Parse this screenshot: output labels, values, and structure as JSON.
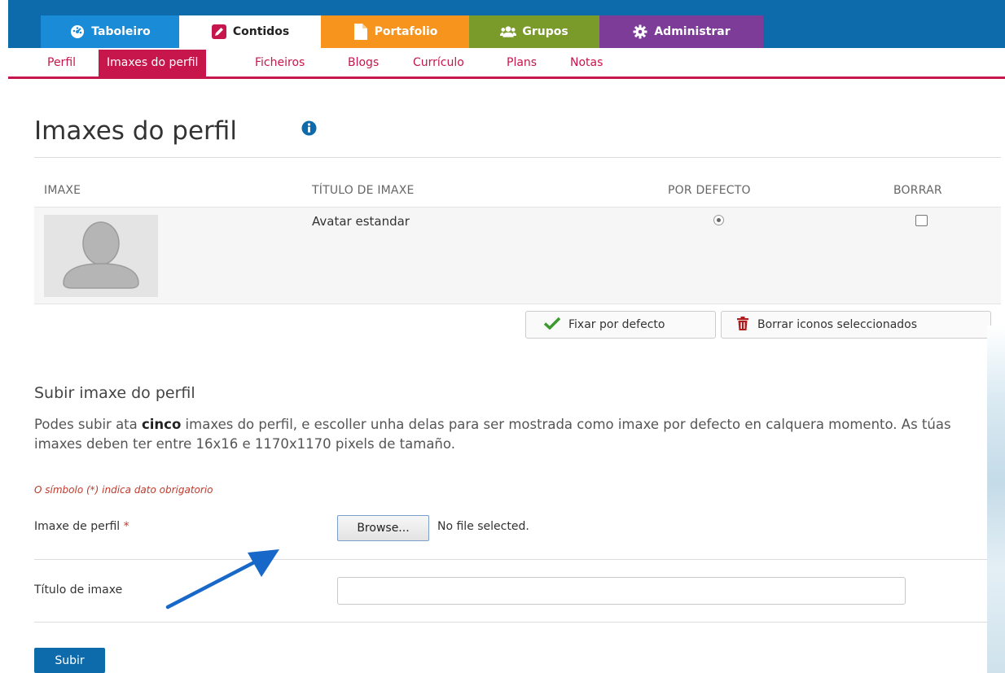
{
  "colors": {
    "top_bar": "#0e6bab",
    "tab_dashboard": "#1a8bd6",
    "tab_content": "#ffffff",
    "tab_portfolio": "#f7941d",
    "tab_groups": "#7a9a2a",
    "tab_admin": "#7d3c98",
    "accent": "#c6164b"
  },
  "main_nav": {
    "tabs": [
      {
        "label": "Taboleiro",
        "icon": "dashboard-icon"
      },
      {
        "label": "Contidos",
        "icon": "pencil-icon"
      },
      {
        "label": "Portafolio",
        "icon": "file-icon"
      },
      {
        "label": "Grupos",
        "icon": "users-icon"
      },
      {
        "label": "Administrar",
        "icon": "gear-icon"
      }
    ]
  },
  "sub_nav": {
    "items": [
      "Perfil",
      "Imaxes do perfil",
      "Ficheiros",
      "Blogs",
      "Currículo",
      "Plans",
      "Notas"
    ],
    "active": "Imaxes do perfil"
  },
  "page": {
    "title": "Imaxes do perfil",
    "info_icon": "info-icon"
  },
  "table": {
    "headers": [
      "IMAXE",
      "TÍTULO DE IMAXE",
      "POR DEFECTO",
      "BORRAR"
    ],
    "rows": [
      {
        "image": "default-avatar",
        "title": "Avatar estandar",
        "default_selected": true,
        "delete_checked": false
      }
    ]
  },
  "actions": {
    "set_default": "Fixar por defecto",
    "delete_selected": "Borrar iconos seleccionados"
  },
  "upload": {
    "heading": "Subir imaxe do perfil",
    "desc_before": "Podes subir ata ",
    "desc_bold": "cinco",
    "desc_after": " imaxes do perfil, e escoller unha delas para ser mostrada como imaxe por defecto en calquera momento. As túas imaxes deben ter entre 16x16 e 1170x1170 pixels de tamaño.",
    "required_note": "O símbolo (*) indica dato obrigatorio",
    "file_label": "Imaxe de perfil",
    "required_mark": "*",
    "browse_label": "Browse...",
    "no_file": "No file selected.",
    "title_label": "Título de imaxe",
    "title_value": "",
    "submit_label": "Subir"
  }
}
